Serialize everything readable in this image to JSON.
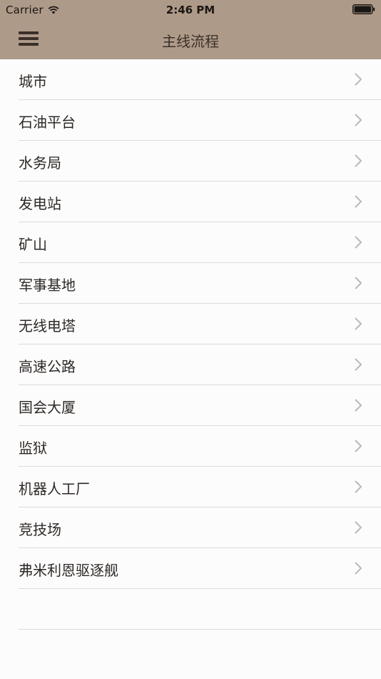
{
  "status_bar": {
    "carrier": "Carrier",
    "time": "2:46 PM",
    "wifi_icon": "wifi-icon",
    "battery_icon": "battery-icon"
  },
  "nav": {
    "title": "主线流程",
    "menu_icon": "hamburger-menu-icon"
  },
  "colors": {
    "header_bg": "#ae9a89",
    "page_bg": "#fdfcfc",
    "separator": "#dedad6",
    "chevron": "#bdb8b3"
  },
  "list": {
    "chevron_icon": "chevron-right-icon",
    "items": [
      {
        "label": "城市"
      },
      {
        "label": "石油平台"
      },
      {
        "label": "水务局"
      },
      {
        "label": "发电站"
      },
      {
        "label": "矿山"
      },
      {
        "label": "军事基地"
      },
      {
        "label": "无线电塔"
      },
      {
        "label": "高速公路"
      },
      {
        "label": "国会大厦"
      },
      {
        "label": "监狱"
      },
      {
        "label": "机器人工厂"
      },
      {
        "label": "竞技场"
      },
      {
        "label": "弗米利恩驱逐舰"
      }
    ]
  }
}
